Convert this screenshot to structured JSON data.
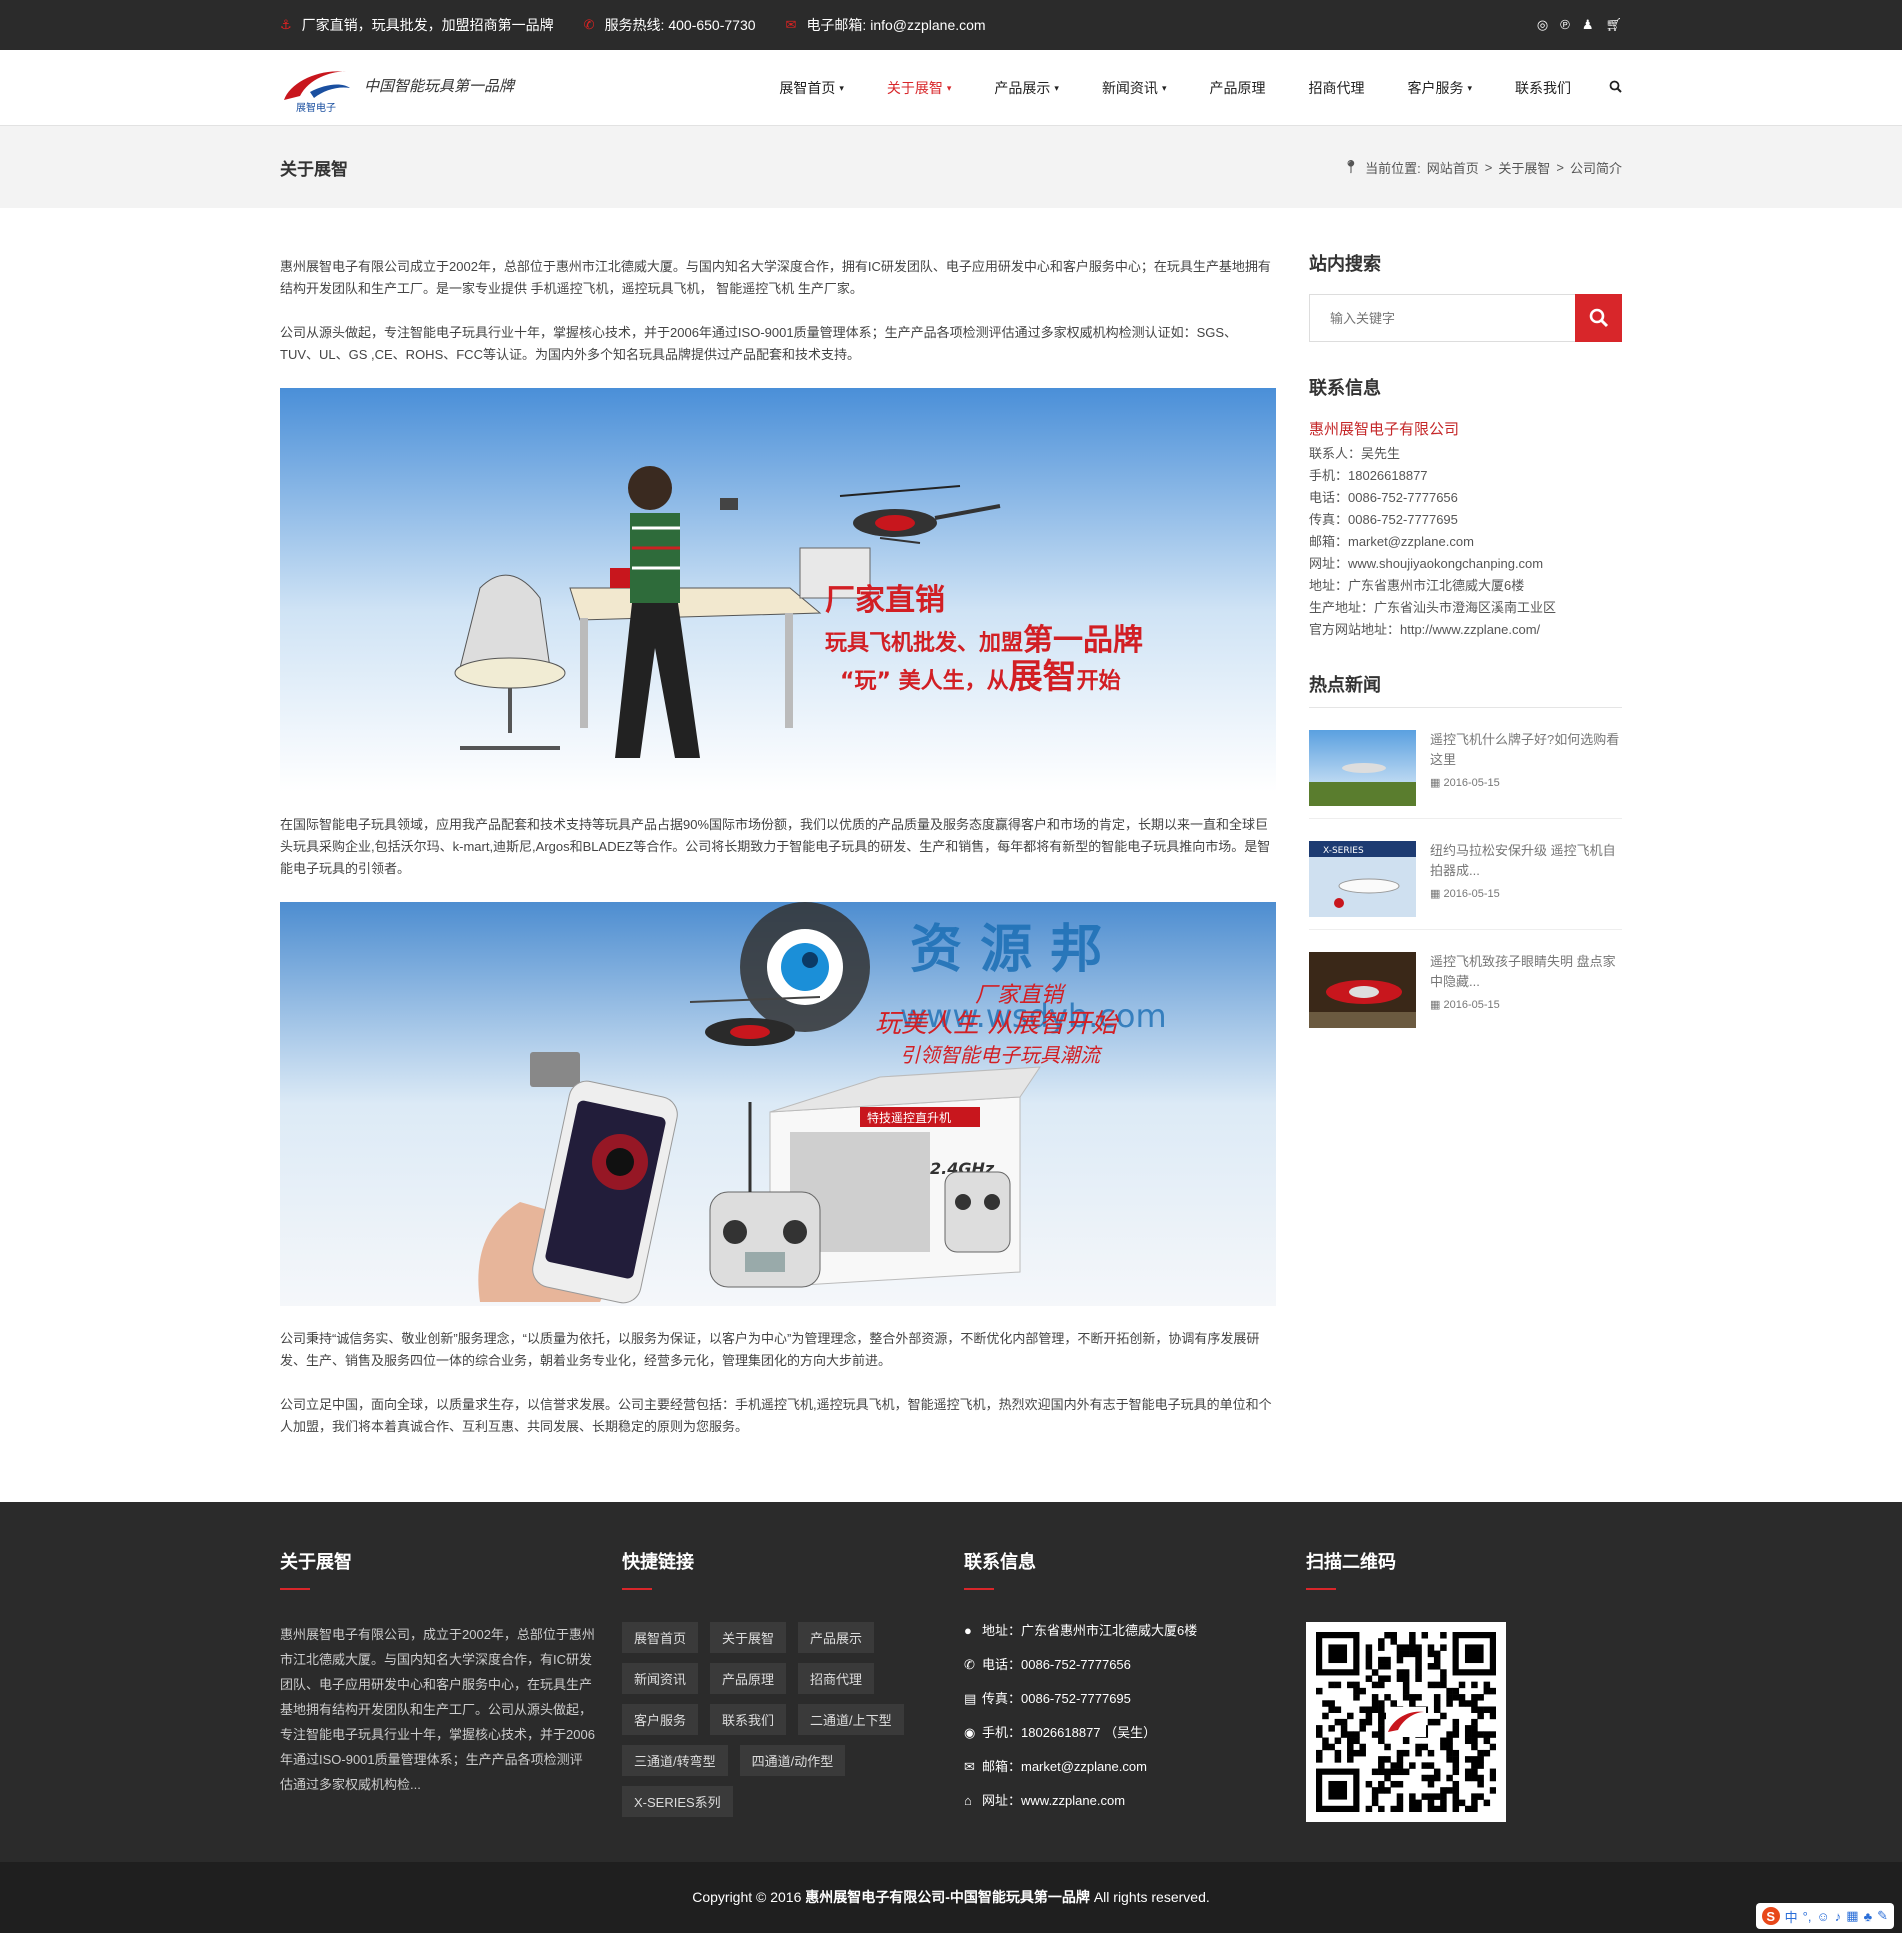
{
  "topbar": {
    "slogan": "厂家直销，玩具批发，加盟招商第一品牌",
    "hotline": "服务热线: 400-650-7730",
    "email": "电子邮箱: info@zzplane.com"
  },
  "logo": {
    "brand": "展智电子",
    "slogan": "中国智能玩具第一品牌"
  },
  "nav": {
    "items": [
      {
        "label": "展智首页",
        "caret": "▾"
      },
      {
        "label": "关于展智",
        "caret": "▾"
      },
      {
        "label": "产品展示",
        "caret": "▾"
      },
      {
        "label": "新闻资讯",
        "caret": "▾"
      },
      {
        "label": "产品原理",
        "caret": ""
      },
      {
        "label": "招商代理",
        "caret": ""
      },
      {
        "label": "客户服务",
        "caret": "▾"
      },
      {
        "label": "联系我们",
        "caret": ""
      }
    ]
  },
  "banner": {
    "title": "关于展智",
    "crumb_prefix": "当前位置:",
    "crumb_home": "网站首页",
    "crumb_sep": ">",
    "crumb_section": "关于展智",
    "crumb_current": "公司简介"
  },
  "content": {
    "p1": "惠州展智电子有限公司成立于2002年，总部位于惠州市江北德威大厦。与国内知名大学深度合作，拥有IC研发团队、电子应用研发中心和客户服务中心；在玩具生产基地拥有结构开发团队和生产工厂。是一家专业提供 手机遥控飞机，遥控玩具飞机， 智能遥控飞机 生产厂家。",
    "p2": "公司从源头做起，专注智能电子玩具行业十年，掌握核心技术，并于2006年通过ISO-9001质量管理体系；生产产品各项检测评估通过多家权威机构检测认证如：SGS、TUV、UL、GS ,CE、ROHS、FCC等认证。为国内外多个知名玩具品牌提供过产品配套和技术支持。",
    "img1_line1": "厂家直销",
    "img1_line2a": "玩具飞机批发、加盟",
    "img1_line2b": "第一品牌",
    "img1_line3a": "“玩” 美人生，从",
    "img1_line3b": "展智",
    "img1_line3c": "开始",
    "p3": "在国际智能电子玩具领域，应用我产品配套和技术支持等玩具产品占据90%国际市场份额，我们以优质的产品质量及服务态度赢得客户和市场的肯定，长期以来一直和全球巨头玩具采购企业,包括沃尔玛、k-mart,迪斯尼,Argos和BLADEZ等合作。公司将长期致力于智能电子玩具的研发、生产和销售，每年都将有新型的智能电子玩具推向市场。是智能电子玩具的引领者。",
    "img2_line1": "厂家直销",
    "img2_line2": "玩美人生 从展智开始",
    "img2_line3": "引领智能电子玩具潮流",
    "img2_watermark": "资 源 邦",
    "img2_watermark_url": "www.wsdyb.com",
    "img2_box_label": "特技遥控直升机",
    "img2_freq": "2.4GHz",
    "p4": "公司秉持“诚信务实、敬业创新”服务理念，“以质量为依托，以服务为保证，以客户为中心”为管理理念，整合外部资源，不断优化内部管理，不断开拓创新，协调有序发展研发、生产、销售及服务四位一体的综合业务，朝着业务专业化，经营多元化，管理集团化的方向大步前进。",
    "p5": "公司立足中国，面向全球，以质量求生存，以信誉求发展。公司主要经营包括：手机遥控飞机,遥控玩具飞机，智能遥控飞机，热烈欢迎国内外有志于智能电子玩具的单位和个人加盟，我们将本着真诚合作、互利互惠、共同发展、长期稳定的原则为您服务。"
  },
  "sidebar": {
    "search_title": "站内搜索",
    "search_placeholder": "输入关键字",
    "contact_title": "联系信息",
    "company": "惠州展智电子有限公司",
    "contacts": [
      "联系人：吴先生",
      "手机：18026618877",
      "电话：0086-752-7777656",
      "传真：0086-752-7777695",
      "邮箱：market@zzplane.com",
      "网址：www.shoujiyaokongchanping.com",
      "地址：广东省惠州市江北德威大厦6楼",
      "生产地址：广东省汕头市澄海区溪南工业区",
      "官方网站地址：http://www.zzplane.com/"
    ],
    "news_title": "热点新闻",
    "news": [
      {
        "title": "遥控飞机什么牌子好?如何选购看这里",
        "date": "2016-05-15",
        "thumb_label": ""
      },
      {
        "title": "纽约马拉松安保升级 遥控飞机自拍器成...",
        "date": "2016-05-15",
        "thumb_label": "X-SERIES"
      },
      {
        "title": "遥控飞机致孩子眼睛失明 盘点家中隐藏...",
        "date": "2016-05-15",
        "thumb_label": ""
      }
    ]
  },
  "footer": {
    "about_title": "关于展智",
    "about_text": "惠州展智电子有限公司，成立于2002年，总部位于惠州市江北德威大厦。与国内知名大学深度合作，有IC研发团队、电子应用研发中心和客户服务中心，在玩具生产基地拥有结构开发团队和生产工厂。公司从源头做起，专注智能电子玩具行业十年，掌握核心技术，并于2006年通过ISO-9001质量管理体系；生产产品各项检测评估通过多家权威机构检...",
    "links_title": "快捷链接",
    "links": [
      "展智首页",
      "关于展智",
      "产品展示",
      "新闻资讯",
      "产品原理",
      "招商代理",
      "客户服务",
      "联系我们",
      "二通道/上下型",
      "三通道/转弯型",
      "四通道/动作型",
      "X-SERIES系列"
    ],
    "contact_title": "联系信息",
    "contacts": [
      {
        "icon": "map-marker-icon",
        "glyph": "●",
        "text": "地址：广东省惠州市江北德威大厦6楼"
      },
      {
        "icon": "phone-icon",
        "glyph": "✆",
        "text": "电话：0086-752-7777656"
      },
      {
        "icon": "fax-icon",
        "glyph": "▤",
        "text": "传真：0086-752-7777695"
      },
      {
        "icon": "mobile-icon",
        "glyph": "◉",
        "text": "手机：18026618877 （吴生）"
      },
      {
        "icon": "mail-icon",
        "glyph": "✉",
        "text": "邮箱：market@zzplane.com"
      },
      {
        "icon": "home-icon",
        "glyph": "⌂",
        "text": "网址：www.zzplane.com"
      }
    ],
    "qr_title": "扫描二维码"
  },
  "copyright": {
    "prefix": "Copyright © 2016 ",
    "company": "惠州展智电子有限公司-中国智能玩具第一品牌",
    "suffix": " All rights reserved."
  },
  "ime": {
    "label": "中"
  },
  "colors": {
    "accent": "#d8262a",
    "dark": "#2b2b2b"
  }
}
